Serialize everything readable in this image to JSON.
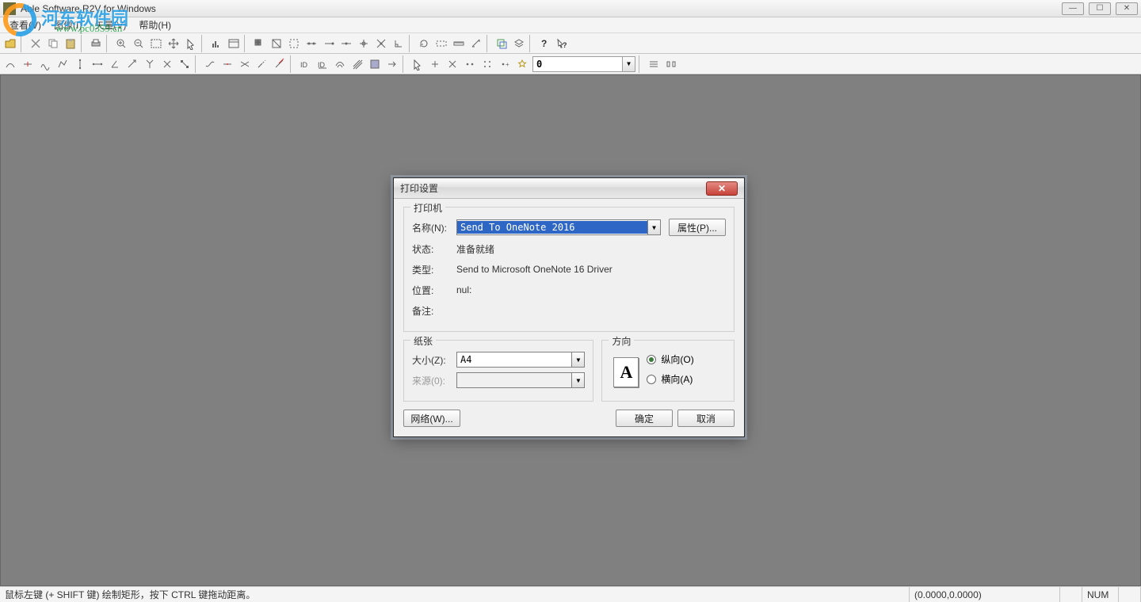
{
  "window": {
    "title": "Able Software R2V for Windows"
  },
  "watermark": {
    "text": "河东软件园",
    "url": "www.pc0359.cn"
  },
  "menu": {
    "items": [
      {
        "label": "查看(V)"
      },
      {
        "label": "图像(I)"
      },
      {
        "label": "矢量(V)"
      },
      {
        "label": "帮助(H)"
      }
    ]
  },
  "toolbar2": {
    "combo_value": "0"
  },
  "dialog": {
    "title": "打印设置",
    "close_tip": "X",
    "printer": {
      "legend": "打印机",
      "name_label": "名称(N):",
      "name_value": "Send To OneNote 2016",
      "prop_button": "属性(P)...",
      "status_label": "状态:",
      "status_value": "准备就绪",
      "type_label": "类型:",
      "type_value": "Send to Microsoft OneNote 16 Driver",
      "where_label": "位置:",
      "where_value": "nul:",
      "comment_label": "备注:",
      "comment_value": ""
    },
    "paper": {
      "legend": "纸张",
      "size_label": "大小(Z):",
      "size_value": "A4",
      "source_label": "来源(0):",
      "source_value": ""
    },
    "orient": {
      "legend": "方向",
      "portrait_label": "纵向(O)",
      "landscape_label": "横向(A)",
      "icon": "A"
    },
    "network_button": "网络(W)...",
    "ok_button": "确定",
    "cancel_button": "取消"
  },
  "status": {
    "hint": "鼠标左键 (+ SHIFT 键) 绘制矩形，按下 CTRL 键拖动距离。",
    "coords": "(0.0000,0.0000)",
    "num": "NUM"
  }
}
